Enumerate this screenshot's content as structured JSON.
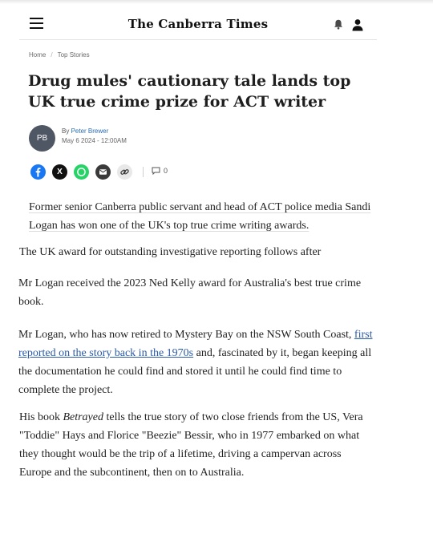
{
  "header": {
    "masthead": "The Canberra Times",
    "menu_icon": "hamburger-menu-icon",
    "bell_icon": "bell-icon",
    "user_icon": "user-icon"
  },
  "breadcrumb": {
    "home": "Home",
    "separator": "/",
    "section": "Top Stories"
  },
  "article": {
    "headline": "Drug mules' cautionary tale lands top UK true crime prize for ACT writer",
    "author": {
      "initials": "PB",
      "by_prefix": "By ",
      "name": "Peter Brewer",
      "date": "May 6 2024 - 12:00AM"
    },
    "share": {
      "facebook": "f",
      "x": "X",
      "whatsapp": "w",
      "email": "email-icon",
      "link": "link-icon",
      "comment_count": "0"
    },
    "paragraphs": {
      "p1": "Former senior Canberra public servant and head of ACT police media Sandi Logan has won one of the UK's top true crime writing awards.",
      "p2": "The UK award for outstanding investigative reporting follows after",
      "p3": "Mr Logan received the 2023 Ned Kelly award for Australia's best true crime book.",
      "p4_before": "Mr Logan, who has now retired to Mystery Bay on the NSW South Coast, ",
      "p4_link": "first reported on the story back in the 1970s",
      "p4_after": " and, fascinated by it, began keeping all the documentation he could find and stored it until he could find time to complete the project.",
      "p5_before": "His book ",
      "p5_title": "Betrayed",
      "p5_after": " tells the true story of two close friends from the US, Vera \"Toddie\" Hays and Florice \"Beezie\" Bessir, who in 1977 embarked on what they thought would be the trip of a lifetime, driving a campervan across Europe and the subcontinent, then on to Australia."
    }
  },
  "colors": {
    "facebook": "#1877f2",
    "x": "#111111",
    "whatsapp": "#25d366",
    "email": "#3a3a3a",
    "link_button": "#e8e8e8",
    "avatar": "#4f5664",
    "link_text": "#2b5aa8"
  }
}
